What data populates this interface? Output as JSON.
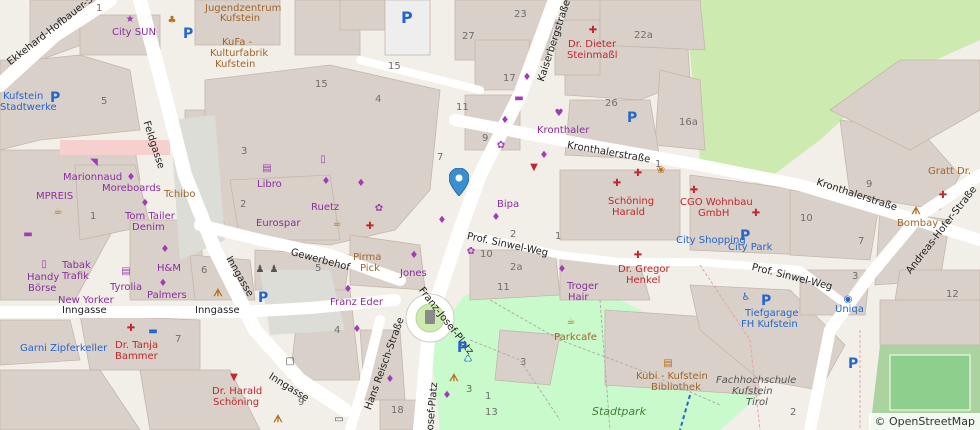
{
  "attribution": "© OpenStreetMap",
  "streets": [
    {
      "id": "ekkehard",
      "text": "Ekkehard-Hofbauer-S"
    },
    {
      "id": "feldgasse",
      "text": "Feldgasse"
    },
    {
      "id": "kaiserberg",
      "text": "Kaiserbergstraße"
    },
    {
      "id": "kronthaler1",
      "text": "Kronthalerstraße"
    },
    {
      "id": "kronthaler2",
      "text": "Kronthalerstraße"
    },
    {
      "id": "andreas",
      "text": "Andreas-Hofer-Straße"
    },
    {
      "id": "gewerbehof",
      "text": "Gewerbehof"
    },
    {
      "id": "inngasse1",
      "text": "Inngasse"
    },
    {
      "id": "inngasse2",
      "text": "Inngasse"
    },
    {
      "id": "inngasse3",
      "text": "Inngasse"
    },
    {
      "id": "sinwel1",
      "text": "Prof. Sinwel-Weg"
    },
    {
      "id": "sinwel2",
      "text": "Prof. Sinwel-Weg"
    },
    {
      "id": "franzjosef",
      "text": "Franz-Josef-Platz"
    },
    {
      "id": "franzjosef2",
      "text": "osef-Platz"
    },
    {
      "id": "hansreisch",
      "text": "Hans Reisch-Straße"
    }
  ],
  "places": [
    {
      "id": "jugendzentrum",
      "text": "Jugendzentrum Kufstein"
    },
    {
      "id": "kufa1",
      "text": "KuFa -"
    },
    {
      "id": "kufa2",
      "text": "Kulturfabrik"
    },
    {
      "id": "kufa3",
      "text": "Kufstein"
    },
    {
      "id": "citysun",
      "text": "City SUN"
    },
    {
      "id": "kufstein",
      "text": "Kufstein"
    },
    {
      "id": "stadtwerke",
      "text": "Stadtwerke"
    },
    {
      "id": "drdieter1",
      "text": "Dr. Dieter"
    },
    {
      "id": "drdieter2",
      "text": "Steinmaßl"
    },
    {
      "id": "kronthaler",
      "text": "Kronthaler"
    },
    {
      "id": "libro",
      "text": "Libro"
    },
    {
      "id": "ruetz",
      "text": "Ruetz"
    },
    {
      "id": "eurospar",
      "text": "Eurospar"
    },
    {
      "id": "marionnaud",
      "text": "Marionnaud"
    },
    {
      "id": "mpreis",
      "text": "MPREIS"
    },
    {
      "id": "moreboards",
      "text": "Moreboards"
    },
    {
      "id": "tchibo",
      "text": "Tchibo"
    },
    {
      "id": "tomtailer1",
      "text": "Tom Tailer"
    },
    {
      "id": "tomtailer2",
      "text": "Denim"
    },
    {
      "id": "handy1",
      "text": "Handy"
    },
    {
      "id": "handy2",
      "text": "Börse"
    },
    {
      "id": "tabak1",
      "text": "Tabak"
    },
    {
      "id": "tabak2",
      "text": "Trafik"
    },
    {
      "id": "tyrolia",
      "text": "Tyrolia"
    },
    {
      "id": "hm",
      "text": "H&M"
    },
    {
      "id": "palmers",
      "text": "Palmers"
    },
    {
      "id": "newyorker",
      "text": "New Yorker"
    },
    {
      "id": "bipa",
      "text": "Bipa"
    },
    {
      "id": "jones",
      "text": "Jones"
    },
    {
      "id": "pirma1",
      "text": "Pirma"
    },
    {
      "id": "pirma2",
      "text": "Pick"
    },
    {
      "id": "franzeder",
      "text": "Franz Eder"
    },
    {
      "id": "schoning1",
      "text": "Schöning"
    },
    {
      "id": "schoning2",
      "text": "Harald"
    },
    {
      "id": "cgo1",
      "text": "CGO Wohnbau"
    },
    {
      "id": "cgo2",
      "text": "GmbH"
    },
    {
      "id": "cityshopping",
      "text": "City Shopping"
    },
    {
      "id": "citypark",
      "text": "City Park"
    },
    {
      "id": "drgregor1",
      "text": "Dr. Gregor"
    },
    {
      "id": "drgregor2",
      "text": "Henkel"
    },
    {
      "id": "troger1",
      "text": "Troger"
    },
    {
      "id": "troger2",
      "text": "Hair"
    },
    {
      "id": "parkcafe",
      "text": "Parkcafe"
    },
    {
      "id": "garni",
      "text": "Garni Zipferkeller"
    },
    {
      "id": "drtanja1",
      "text": "Dr. Tanja"
    },
    {
      "id": "drtanja2",
      "text": "Bammer"
    },
    {
      "id": "drharald1",
      "text": "Dr. Harald"
    },
    {
      "id": "drharald2",
      "text": "Schöning"
    },
    {
      "id": "kubi1",
      "text": "Kubi - Kufstein"
    },
    {
      "id": "kubi2",
      "text": "Bibliothek"
    },
    {
      "id": "fachhochschule1",
      "text": "Fachhochschule"
    },
    {
      "id": "fachhochschule2",
      "text": "Kufstein"
    },
    {
      "id": "fachhochschule3",
      "text": "Tirol"
    },
    {
      "id": "stadtpark",
      "text": "Stadtpark"
    },
    {
      "id": "tiefgarage1",
      "text": "Tiefgarage"
    },
    {
      "id": "tiefgarage2",
      "text": "FH Kufstein"
    },
    {
      "id": "uniqa",
      "text": "Uniqa"
    },
    {
      "id": "bombay",
      "text": "Bombay"
    },
    {
      "id": "grattdr",
      "text": "Gratt Dr."
    }
  ],
  "numbers": [
    {
      "id": "n1",
      "text": "1"
    },
    {
      "id": "n2",
      "text": "23"
    },
    {
      "id": "n3",
      "text": "27"
    },
    {
      "id": "n4",
      "text": "22a"
    },
    {
      "id": "n5",
      "text": "17"
    },
    {
      "id": "n6",
      "text": "15"
    },
    {
      "id": "n7",
      "text": "5"
    },
    {
      "id": "n8",
      "text": "11"
    },
    {
      "id": "n9",
      "text": "9"
    },
    {
      "id": "n10",
      "text": "16a"
    },
    {
      "id": "n11",
      "text": "3"
    },
    {
      "id": "n12",
      "text": "2"
    },
    {
      "id": "n13",
      "text": "1"
    },
    {
      "id": "n14",
      "text": "7"
    },
    {
      "id": "n15",
      "text": "5"
    },
    {
      "id": "n16",
      "text": "2"
    },
    {
      "id": "n17",
      "text": "10"
    },
    {
      "id": "n18",
      "text": "2a"
    },
    {
      "id": "n19",
      "text": "11"
    },
    {
      "id": "n20",
      "text": "1"
    },
    {
      "id": "n21",
      "text": "6"
    },
    {
      "id": "n22",
      "text": "4"
    },
    {
      "id": "n23",
      "text": "7"
    },
    {
      "id": "n24",
      "text": "9"
    },
    {
      "id": "n25",
      "text": "7"
    },
    {
      "id": "n26",
      "text": "10"
    },
    {
      "id": "n27",
      "text": "3"
    },
    {
      "id": "n28",
      "text": "12"
    },
    {
      "id": "n29",
      "text": "9"
    },
    {
      "id": "n30",
      "text": "18"
    },
    {
      "id": "n31",
      "text": "3"
    },
    {
      "id": "n32",
      "text": "1"
    },
    {
      "id": "n33",
      "text": "3"
    },
    {
      "id": "n34",
      "text": "13"
    },
    {
      "id": "n35",
      "text": "2"
    },
    {
      "id": "n36",
      "text": "1"
    },
    {
      "id": "n37",
      "text": "15"
    },
    {
      "id": "n38",
      "text": "4"
    },
    {
      "id": "n39",
      "text": "26"
    }
  ],
  "colors": {
    "background": "#f2efe9",
    "building": "#d9d0c9",
    "road": "#ffffff",
    "park": "#c8facc",
    "grass": "#cdebb0",
    "water": "#aad3df",
    "shop": "#ac39ac",
    "health": "#bf0000",
    "parking": "#2666cc",
    "food": "#c77400",
    "marker": "#3b8fd1"
  },
  "marker_icon": "map-pin-icon"
}
